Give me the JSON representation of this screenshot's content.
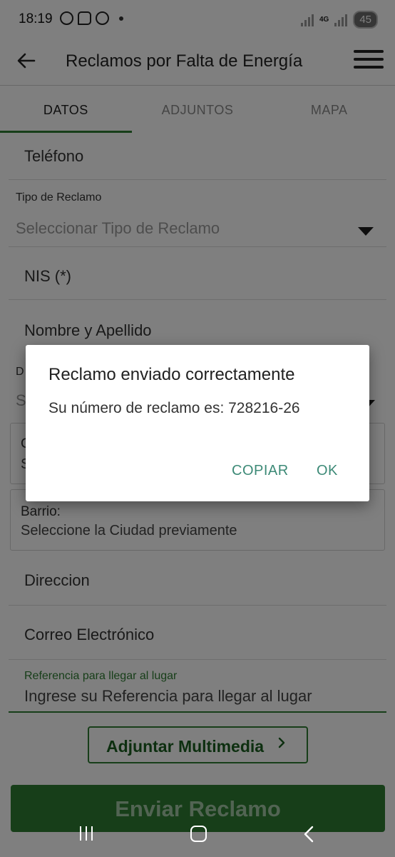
{
  "status_bar": {
    "time": "18:19",
    "network": "4G",
    "battery": "45"
  },
  "app_bar": {
    "title": "Reclamos por Falta de Energía"
  },
  "tabs": [
    {
      "label": "DATOS",
      "active": true
    },
    {
      "label": "ADJUNTOS",
      "active": false
    },
    {
      "label": "MAPA",
      "active": false
    }
  ],
  "form": {
    "telefono": "Teléfono",
    "tipo_label": "Tipo de Reclamo",
    "tipo_placeholder": "Seleccionar Tipo de Reclamo",
    "nis": "NIS (*)",
    "nombre": "Nombre y Apellido",
    "partial_label": "D",
    "partial_select": "S",
    "partial_box_label": "C",
    "partial_box_value": "S",
    "barrio_label": "Barrio:",
    "barrio_value": "Seleccione la Ciudad previamente",
    "direccion": "Direccion",
    "correo": "Correo Electrónico",
    "referencia_label": "Referencia para llegar al lugar",
    "referencia_placeholder": "Ingrese su Referencia para llegar al lugar",
    "attach_button": "Adjuntar Multimedia",
    "send_button": "Enviar Reclamo"
  },
  "dialog": {
    "title": "Reclamo enviado correctamente",
    "message": "Su número de reclamo es: 728216-26",
    "copy_button": "COPIAR",
    "ok_button": "OK"
  },
  "colors": {
    "accent": "#2e7d32",
    "dialog_button": "#3d8a77"
  }
}
